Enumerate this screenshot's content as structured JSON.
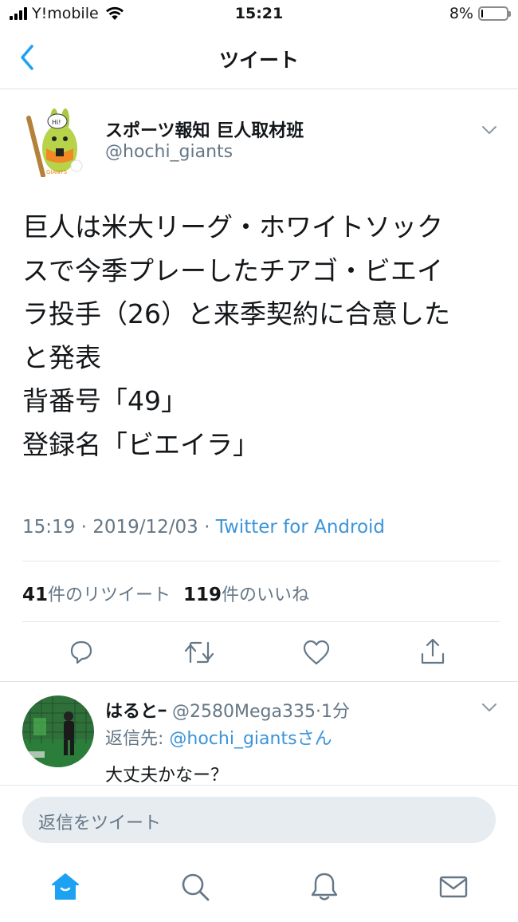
{
  "status_bar": {
    "carrier": "Y!mobile",
    "time": "15:21",
    "battery": "8%",
    "battery_level": 0.08
  },
  "nav": {
    "title": "ツイート",
    "back_icon": "chevron-left-icon"
  },
  "tweet": {
    "author_name": "スポーツ報知 巨人取材班",
    "author_handle": "@hochi_giants",
    "avatar_text": "GIANTS",
    "body_lines": [
      "巨人は米大リーグ・ホワイトソック",
      "スで今季プレーしたチアゴ・ビエイ",
      "ラ投手（26）と来季契約に合意した",
      "と発表",
      "背番号「49」",
      "登録名「ビエイラ」"
    ],
    "time": "15:19",
    "date": "2019/12/03",
    "source": "Twitter for Android",
    "retweet_count": "41",
    "retweet_label": "件のリツイート",
    "like_count": "119",
    "like_label": "件のいいね",
    "actions": [
      "reply-icon",
      "retweet-icon",
      "like-icon",
      "share-icon"
    ]
  },
  "reply": {
    "name": "はるとｰ",
    "handle": "@2580Mega335",
    "time": "1分",
    "replying_to_prefix": "返信先: ",
    "replying_to_handle": "@hochi_giants",
    "replying_to_suffix": "さん",
    "text": "大丈夫かなー？"
  },
  "composer": {
    "placeholder": "返信をツイート"
  },
  "tabbar": {
    "items": [
      "home-icon",
      "search-icon",
      "notifications-icon",
      "messages-icon"
    ],
    "active_color": "#1da1f2"
  },
  "colors": {
    "accent": "#1da1f2",
    "link": "#3b94d9",
    "secondary_text": "#657786",
    "divider": "#e1e8ed"
  }
}
